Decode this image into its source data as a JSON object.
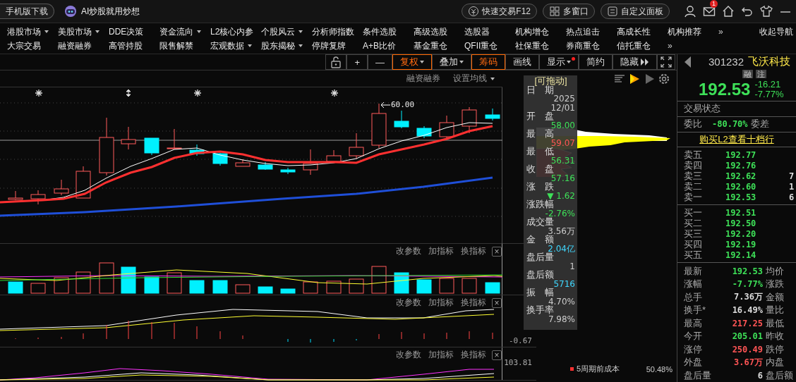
{
  "top_bar": {
    "download": "手机版下载",
    "ai_banner": "AI炒股就用炒想",
    "buttons": [
      "快速交易F12",
      "多窗口",
      "自定义面板"
    ],
    "mail_badge": "1"
  },
  "nav": {
    "rows": [
      {
        "items": [
          {
            "label": "港股市场",
            "dropdown": true
          },
          {
            "label": "美股市场",
            "dropdown": true
          },
          {
            "label": "DDE决策",
            "dropdown": false
          },
          {
            "label": "资金流向",
            "dropdown": true
          },
          {
            "label": "L2核心内参",
            "dropdown": false
          },
          {
            "label": "个股风云",
            "dropdown": true
          },
          {
            "label": "分析师指数",
            "dropdown": false
          },
          {
            "label": "条件选股",
            "dropdown": false
          },
          {
            "label": "高级选股",
            "dropdown": false
          },
          {
            "label": "选股器",
            "dropdown": false
          },
          {
            "label": "机构增仓",
            "dropdown": false
          },
          {
            "label": "热点追击",
            "dropdown": false
          },
          {
            "label": "高成长性",
            "dropdown": false
          },
          {
            "label": "机构推荐",
            "dropdown": false
          }
        ],
        "more": "»"
      },
      {
        "items": [
          {
            "label": "大宗交易",
            "dropdown": false
          },
          {
            "label": "融资融券",
            "dropdown": false
          },
          {
            "label": "高管持股",
            "dropdown": false
          },
          {
            "label": "限售解禁",
            "dropdown": false
          },
          {
            "label": "宏观数据",
            "dropdown": true
          },
          {
            "label": "股东揭秘",
            "dropdown": true
          },
          {
            "label": "停牌复牌",
            "dropdown": false
          },
          {
            "label": "A+B比价",
            "dropdown": false
          },
          {
            "label": "基金重仓",
            "dropdown": false
          },
          {
            "label": "QFII重仓",
            "dropdown": false
          },
          {
            "label": "社保重仓",
            "dropdown": false
          },
          {
            "label": "券商重仓",
            "dropdown": false
          },
          {
            "label": "信托重仓",
            "dropdown": false
          }
        ],
        "more": "»"
      }
    ],
    "collapse": "收起导航"
  },
  "chart_toolbar": [
    {
      "label": "+",
      "dropdown": false,
      "selected": false,
      "alert_dot": false
    },
    {
      "label": "—",
      "dropdown": false,
      "selected": false,
      "alert_dot": false
    },
    {
      "label": "复权",
      "dropdown": true,
      "selected": true,
      "alert_dot": false
    },
    {
      "label": "叠加",
      "dropdown": true,
      "selected": false,
      "alert_dot": false
    },
    {
      "label": "筹码",
      "dropdown": false,
      "selected": true,
      "alert_dot": false
    },
    {
      "label": "画线",
      "dropdown": false,
      "selected": false,
      "alert_dot": false
    },
    {
      "label": "显示",
      "dropdown": true,
      "selected": false,
      "alert_dot": true
    },
    {
      "label": "简约",
      "dropdown": false,
      "selected": false,
      "alert_dot": false
    },
    {
      "label": "隐藏",
      "dropdown": false,
      "selected": false,
      "alert_dot": false
    }
  ],
  "chart_subbar": [
    {
      "label": "融资融券",
      "dropdown": false
    },
    {
      "label": "设置均线",
      "dropdown": true
    }
  ],
  "price_chart": {
    "max_marker": "60.00"
  },
  "indicator_panes": [
    {
      "buttons": [
        "改参数",
        "加指标",
        "换指标"
      ],
      "close": "×"
    },
    {
      "buttons": [
        "改参数",
        "加指标",
        "换指标"
      ],
      "close": "×",
      "axis_label": "-0.67"
    },
    {
      "buttons": [
        "改参数",
        "加指标",
        "换指标"
      ],
      "close": "×",
      "axis_label": "103.81"
    }
  ],
  "data_panel": {
    "title": "[可拖动]",
    "fields": [
      {
        "label": "日　期",
        "lines": [
          "2025",
          "12/01"
        ],
        "color": "#cccccc"
      },
      {
        "label": "开　盘",
        "lines": [
          "58.00"
        ],
        "color": "#3ee058"
      },
      {
        "label": "最　高",
        "lines": [
          "59.07"
        ],
        "color": "#ff5555"
      },
      {
        "label": "最　低",
        "lines": [
          "56.31"
        ],
        "color": "#3ee058"
      },
      {
        "label": "收　盘",
        "lines": [
          "57.16"
        ],
        "color": "#3ee058"
      },
      {
        "label": "涨　跌",
        "lines": [
          "▼ 1.62"
        ],
        "color": "#3ee058"
      },
      {
        "label": "涨跌幅",
        "lines": [
          "-2.76%"
        ],
        "color": "#3ee058"
      },
      {
        "label": "成交量",
        "lines": [
          "3.56万"
        ],
        "color": "#cccccc"
      },
      {
        "label": "金　额",
        "lines": [
          "2.04亿"
        ],
        "color": "#3fd8ff"
      },
      {
        "label": "盘后量",
        "lines": [
          "1"
        ],
        "color": "#cccccc"
      },
      {
        "label": "盘后额",
        "lines": [
          "5716"
        ],
        "color": "#3fd8ff"
      },
      {
        "label": "振　幅",
        "lines": [
          "4.70%"
        ],
        "color": "#cccccc"
      },
      {
        "label": "换手率",
        "lines": [
          "7.98%"
        ],
        "color": "#cccccc"
      }
    ]
  },
  "chip_legend": [
    {
      "color": "#ff3030",
      "label": "5周期前成本",
      "value": "50.48%"
    }
  ],
  "quote_panel": {
    "code": "301232",
    "name": "飞沃科技",
    "tags": [
      "融",
      "注"
    ],
    "price": "192.53",
    "change": "-16.21",
    "change_pct": "-7.77%",
    "color": "#3ee058",
    "trade_status": "交易状态",
    "ratio": {
      "label": "委比",
      "value": "-80.70%",
      "color": "#3ee058",
      "label2": "委差"
    },
    "l2_link": "购买L2查看十档行",
    "asks": [
      {
        "label": "卖五",
        "price": "192.77"
      },
      {
        "label": "卖四",
        "price": "192.76"
      },
      {
        "label": "卖三",
        "price": "192.62",
        "volume": "7"
      },
      {
        "label": "卖二",
        "price": "192.60",
        "volume": "1"
      },
      {
        "label": "卖一",
        "price": "192.53",
        "volume": "6"
      }
    ],
    "bids": [
      {
        "label": "买一",
        "price": "192.51"
      },
      {
        "label": "买二",
        "price": "192.50"
      },
      {
        "label": "买三",
        "price": "192.20"
      },
      {
        "label": "买四",
        "price": "192.19"
      },
      {
        "label": "买五",
        "price": "192.14"
      }
    ],
    "stats": [
      {
        "label": "最新",
        "value": "192.53",
        "color": "#3ee058",
        "label2": "均价"
      },
      {
        "label": "涨幅",
        "value": "-7.77%",
        "color": "#3ee058",
        "label2": "涨跌"
      },
      {
        "label": "总手",
        "value": "7.36万",
        "color": "#dddddd",
        "label2": "金额"
      },
      {
        "label": "换手*",
        "value": "16.49%",
        "color": "#dddddd",
        "label2": "量比"
      },
      {
        "label": "最高",
        "value": "217.25",
        "color": "#ff5555",
        "label2": "最低"
      },
      {
        "label": "今开",
        "value": "205.01",
        "color": "#3ee058",
        "label2": "昨收"
      },
      {
        "label": "涨停",
        "value": "250.49",
        "color": "#ff5555",
        "label2": "跌停"
      },
      {
        "label": "外盘",
        "value": "3.67万",
        "color": "#ff5555",
        "label2": "内盘"
      },
      {
        "label": "盘后量",
        "value": "6",
        "color": "#dddddd",
        "label2": "盘后额"
      }
    ]
  }
}
